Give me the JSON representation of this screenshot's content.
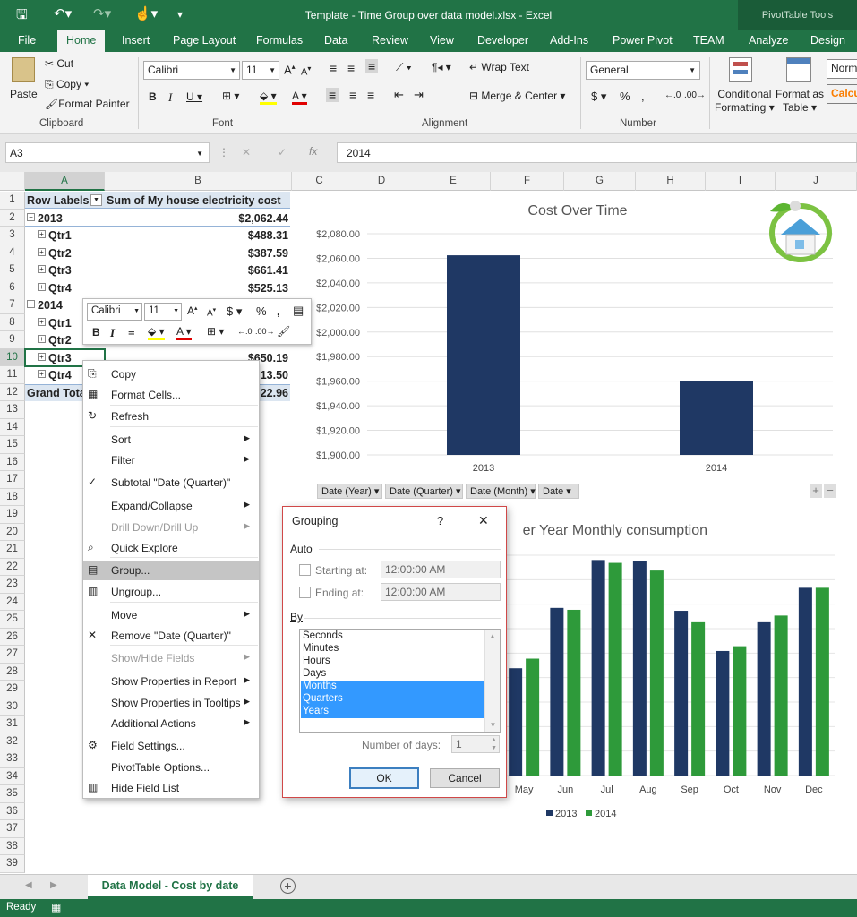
{
  "window": {
    "title": "Template - Time Group over data model.xlsx - Excel",
    "context_tab": "PivotTable Tools"
  },
  "tabs": [
    "File",
    "Home",
    "Insert",
    "Page Layout",
    "Formulas",
    "Data",
    "Review",
    "View",
    "Developer",
    "Add-Ins",
    "Power Pivot",
    "TEAM",
    "Analyze",
    "Design"
  ],
  "ribbon": {
    "clipboard": {
      "paste": "Paste",
      "cut": "Cut",
      "copy": "Copy",
      "format_painter": "Format Painter",
      "label": "Clipboard"
    },
    "font": {
      "family": "Calibri",
      "size": "11",
      "label": "Font"
    },
    "alignment": {
      "wrap": "Wrap Text",
      "merge": "Merge & Center",
      "label": "Alignment"
    },
    "number": {
      "format": "General",
      "label": "Number"
    },
    "styles": {
      "conditional1": "Conditional",
      "conditional2": "Formatting",
      "format_as1": "Format as",
      "format_as2": "Table",
      "normal": "Norm",
      "calc": "Calcu"
    }
  },
  "formula": {
    "namebox": "A3",
    "value": "2014",
    "fx": "fx"
  },
  "columns": [
    "A",
    "B",
    "C",
    "D",
    "E",
    "F",
    "G",
    "H",
    "I",
    "J"
  ],
  "rows": [
    "1",
    "2",
    "3",
    "4",
    "5",
    "6",
    "7",
    "8",
    "9",
    "10",
    "11",
    "12",
    "13",
    "14",
    "15",
    "16",
    "17",
    "18",
    "19",
    "20",
    "21",
    "22",
    "23",
    "24",
    "25",
    "26",
    "27",
    "28",
    "29",
    "30",
    "31",
    "32",
    "33",
    "34",
    "35",
    "36",
    "37",
    "38",
    "39"
  ],
  "pivot": {
    "header_a": "Row Labels",
    "header_b": "Sum of My house electricity cost",
    "rows": [
      {
        "label": "2013",
        "value": "$2,062.44",
        "level": 0
      },
      {
        "label": "Qtr1",
        "value": "$488.31",
        "level": 1
      },
      {
        "label": "Qtr2",
        "value": "$387.59",
        "level": 1
      },
      {
        "label": "Qtr3",
        "value": "$661.41",
        "level": 1
      },
      {
        "label": "Qtr4",
        "value": "$525.13",
        "level": 1
      },
      {
        "label": "2014",
        "value": "",
        "level": 0
      },
      {
        "label": "Qtr1",
        "value": "",
        "level": 1
      },
      {
        "label": "Qtr2",
        "value": "",
        "level": 1
      },
      {
        "label": "Qtr3",
        "value": "$650.19",
        "level": 1
      },
      {
        "label": "Qtr4",
        "value": "13.50",
        "level": 1
      },
      {
        "label": "Grand Tota",
        "value": "22.96",
        "level": 0
      }
    ]
  },
  "minitoolbar": {
    "font": "Calibri",
    "size": "11"
  },
  "context_menu": [
    {
      "label": "Copy",
      "icon": "copy-icon",
      "state": "normal"
    },
    {
      "label": "Format Cells...",
      "icon": "format-cells-icon",
      "state": "normal"
    },
    {
      "label": "Refresh",
      "icon": "refresh-icon",
      "state": "normal"
    },
    {
      "label": "Sort",
      "state": "normal",
      "submenu": true
    },
    {
      "label": "Filter",
      "state": "normal",
      "submenu": true
    },
    {
      "label": "Subtotal \"Date (Quarter)\"",
      "icon": "check-icon",
      "state": "normal"
    },
    {
      "label": "Expand/Collapse",
      "state": "normal",
      "submenu": true
    },
    {
      "label": "Drill Down/Drill Up",
      "state": "disabled",
      "submenu": true
    },
    {
      "label": "Quick Explore",
      "icon": "quick-explore-icon",
      "state": "normal"
    },
    {
      "label": "Group...",
      "icon": "group-icon",
      "state": "highlighted"
    },
    {
      "label": "Ungroup...",
      "icon": "ungroup-icon",
      "state": "normal"
    },
    {
      "label": "Move",
      "state": "normal",
      "submenu": true
    },
    {
      "label": "Remove \"Date (Quarter)\"",
      "icon": "remove-icon",
      "state": "normal"
    },
    {
      "label": "Show/Hide Fields",
      "state": "disabled",
      "submenu": true
    },
    {
      "label": "Show Properties in Report",
      "state": "normal",
      "submenu": true
    },
    {
      "label": "Show Properties in Tooltips",
      "state": "normal",
      "submenu": true
    },
    {
      "label": "Additional Actions",
      "state": "normal",
      "submenu": true
    },
    {
      "label": "Field Settings...",
      "icon": "field-settings-icon",
      "state": "normal"
    },
    {
      "label": "PivotTable Options...",
      "state": "normal"
    },
    {
      "label": "Hide Field List",
      "icon": "field-list-icon",
      "state": "normal"
    }
  ],
  "dialog": {
    "title": "Grouping",
    "help": "?",
    "close": "✕",
    "auto_label": "Auto",
    "starting_label": "Starting at:",
    "starting_value": "12:00:00 AM",
    "ending_label": "Ending at:",
    "ending_value": "12:00:00 AM",
    "by_label": "By",
    "by_options": [
      {
        "label": "Seconds",
        "selected": false
      },
      {
        "label": "Minutes",
        "selected": false
      },
      {
        "label": "Hours",
        "selected": false
      },
      {
        "label": "Days",
        "selected": false
      },
      {
        "label": "Months",
        "selected": true
      },
      {
        "label": "Quarters",
        "selected": true
      },
      {
        "label": "Years",
        "selected": true
      }
    ],
    "days_label": "Number of days:",
    "days_value": "1",
    "ok": "OK",
    "cancel": "Cancel"
  },
  "chart_data": [
    {
      "type": "bar",
      "title": "Cost Over Time",
      "categories": [
        "2013",
        "2014"
      ],
      "values": [
        2062.44,
        1960
      ],
      "ylim": [
        1900,
        2080
      ],
      "yticks": [
        "$1,900.00",
        "$1,920.00",
        "$1,940.00",
        "$1,960.00",
        "$1,980.00",
        "$2,000.00",
        "$2,020.00",
        "$2,040.00",
        "$2,060.00",
        "$2,080.00"
      ],
      "color": "#1f3864",
      "filter_buttons": [
        "Date (Year)",
        "Date (Quarter)",
        "Date (Month)",
        "Date"
      ]
    },
    {
      "type": "bar",
      "title": "er Year Monthly consumption",
      "categories": [
        "May",
        "Jun",
        "Jul",
        "Aug",
        "Sep",
        "Oct",
        "Nov",
        "Dec"
      ],
      "series": [
        {
          "name": "2013",
          "color": "#1f3864",
          "values": [
            112,
            175,
            225,
            224,
            172,
            130,
            160,
            196
          ]
        },
        {
          "name": "2014",
          "color": "#2e9a3a",
          "values": [
            122,
            173,
            222,
            214,
            160,
            135,
            167,
            196
          ]
        }
      ],
      "ylim": [
        0,
        230
      ]
    }
  ],
  "sheet_tab": "Data Model - Cost by date",
  "status": "Ready"
}
